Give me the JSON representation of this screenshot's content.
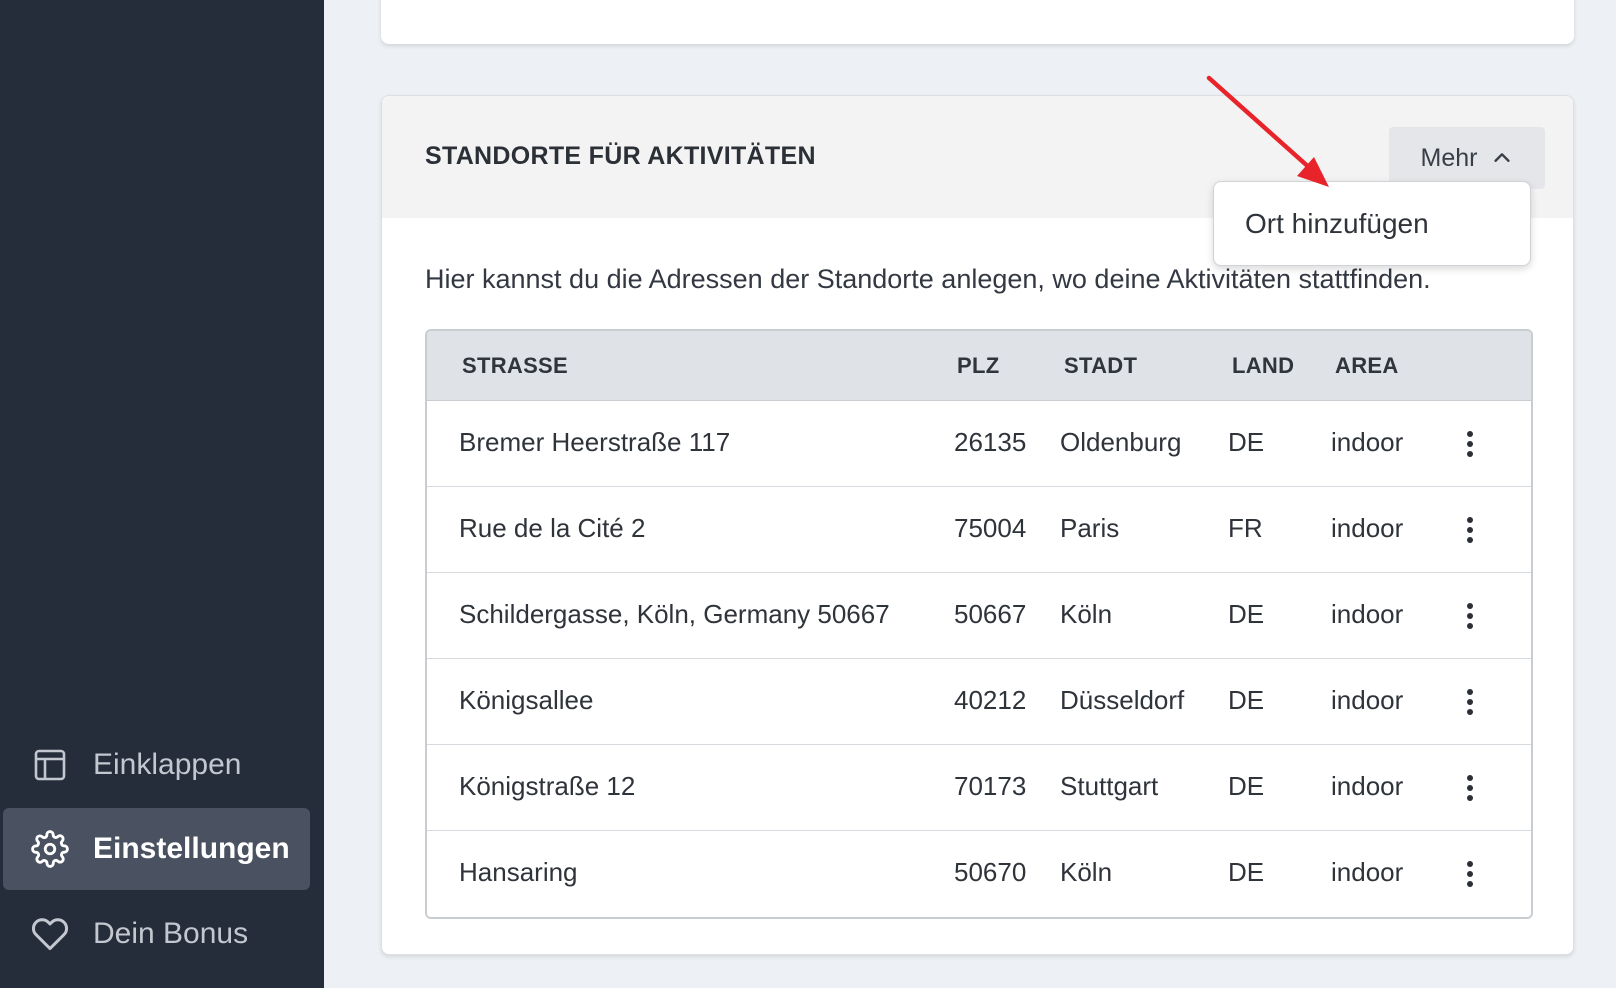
{
  "sidebar": {
    "items": [
      {
        "label": "Einklappen",
        "icon": "sidebar-collapse-icon",
        "active": false
      },
      {
        "label": "Einstellungen",
        "icon": "gear-icon",
        "active": true
      },
      {
        "label": "Dein Bonus",
        "icon": "heart-icon",
        "active": false
      }
    ]
  },
  "section": {
    "title": "STANDORTE FÜR AKTIVITÄTEN",
    "more_button": "Mehr",
    "more_icon": "chevron-up-icon",
    "description": "Hier kannst du die Adressen der Standorte anlegen, wo deine Aktivitäten stattfinden."
  },
  "dropdown": {
    "items": [
      {
        "label": "Ort hinzufügen"
      }
    ]
  },
  "table": {
    "headers": [
      "STRASSE",
      "PLZ",
      "STADT",
      "LAND",
      "AREA"
    ],
    "rows": [
      [
        "Bremer Heerstraße 117",
        "26135",
        "Oldenburg",
        "DE",
        "indoor"
      ],
      [
        "Rue de la Cité 2",
        "75004",
        "Paris",
        "FR",
        "indoor"
      ],
      [
        "Schildergasse, Köln, Germany 50667",
        "50667",
        "Köln",
        "DE",
        "indoor"
      ],
      [
        "Königsallee",
        "40212",
        "Düsseldorf",
        "DE",
        "indoor"
      ],
      [
        "Königstraße 12",
        "70173",
        "Stuttgart",
        "DE",
        "indoor"
      ],
      [
        "Hansaring",
        "50670",
        "Köln",
        "DE",
        "indoor"
      ]
    ]
  },
  "colors": {
    "sidebar_bg": "#262d3a",
    "sidebar_active": "#4a5160",
    "annotation_arrow": "#e8242a",
    "page_bg": "#edf0f4"
  }
}
